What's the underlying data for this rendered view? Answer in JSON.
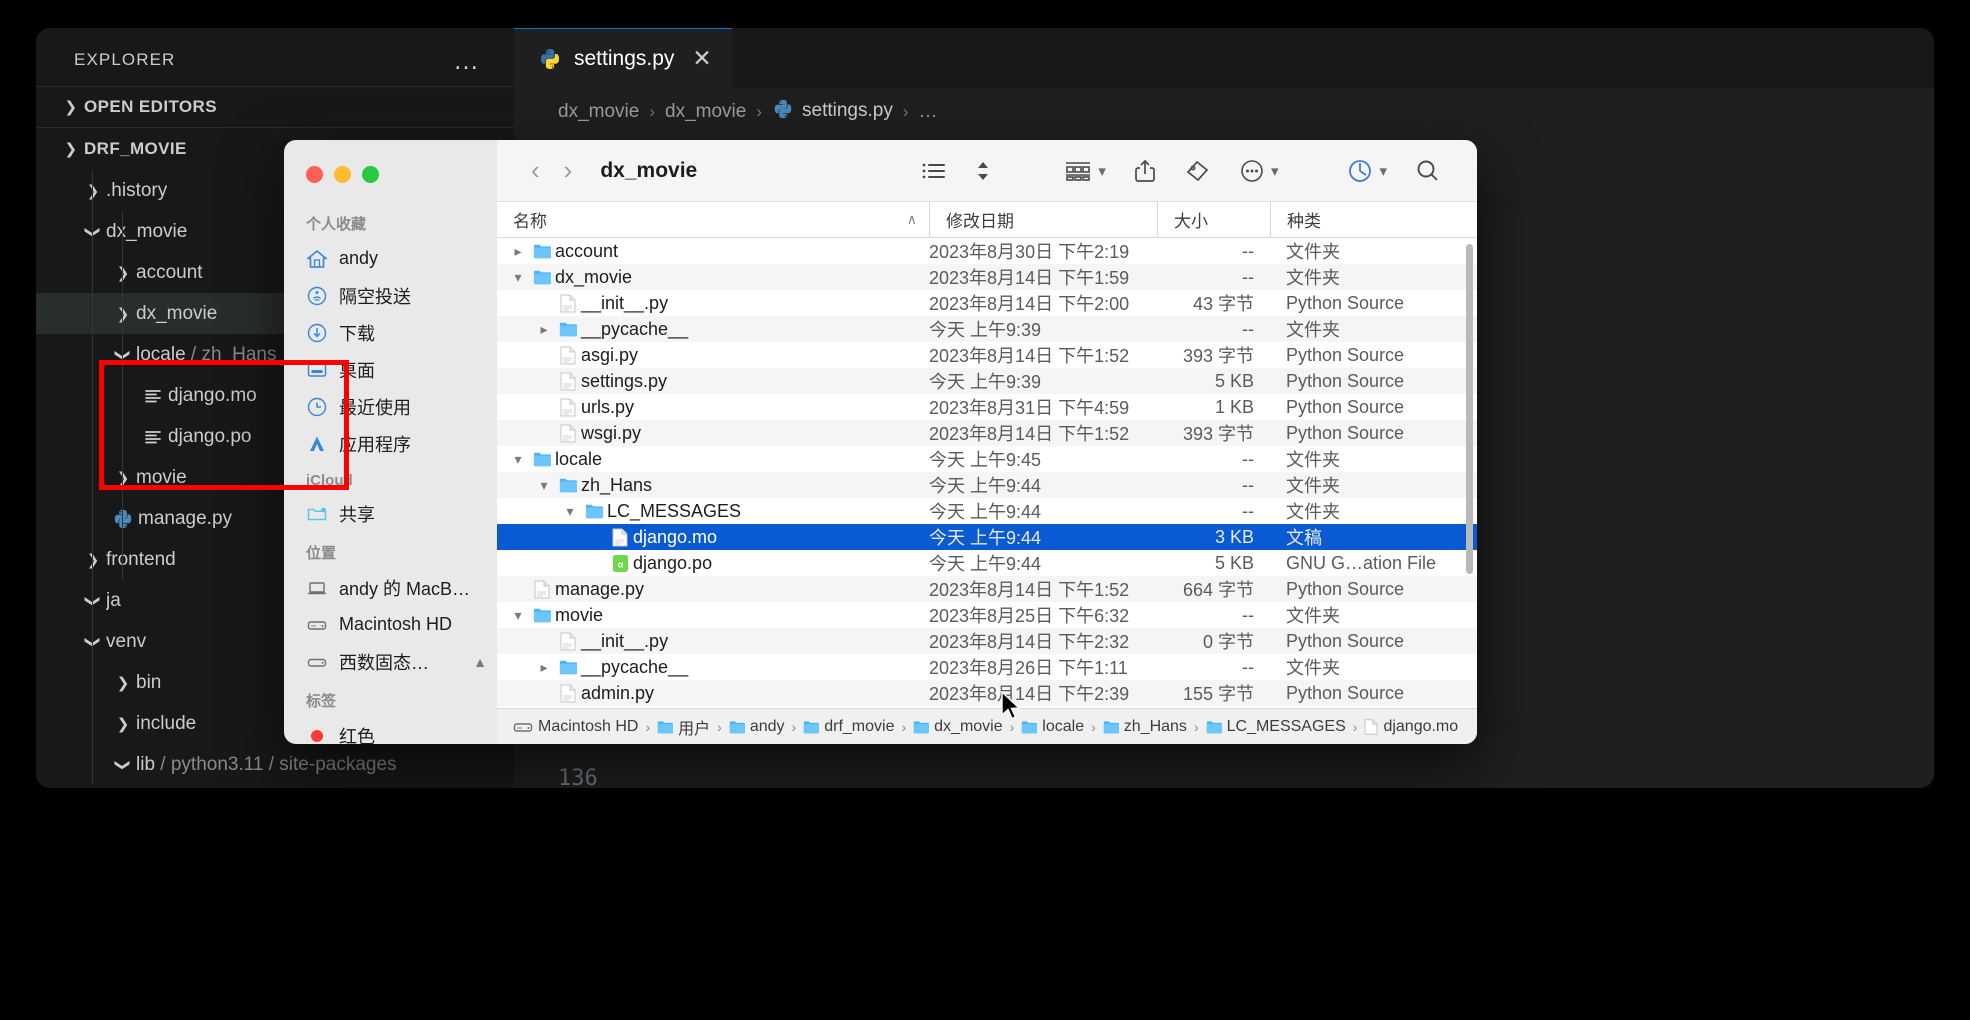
{
  "vscode": {
    "explorer": {
      "title": "EXPLORER",
      "more_label": "…",
      "open_editors_label": "OPEN EDITORS",
      "project_label": "DRF_MOVIE"
    },
    "tree": [
      {
        "label": ".history",
        "icon": "folder",
        "state": "collapsed",
        "indent": 1
      },
      {
        "label": "dx_movie",
        "icon": "folder",
        "state": "expanded",
        "indent": 1
      },
      {
        "label": "account",
        "icon": "folder",
        "state": "collapsed",
        "indent": 2
      },
      {
        "label": "dx_movie",
        "icon": "folder",
        "state": "collapsed",
        "indent": 2,
        "selected": true
      },
      {
        "label": "locale",
        "suffix": "/ zh_Hans",
        "icon": "folder",
        "state": "expanded",
        "indent": 2
      },
      {
        "label": "django.mo",
        "icon": "text-file",
        "state": "leaf",
        "indent": 3
      },
      {
        "label": "django.po",
        "icon": "text-file",
        "state": "leaf",
        "indent": 3
      },
      {
        "label": "movie",
        "icon": "folder",
        "state": "collapsed",
        "indent": 2
      },
      {
        "label": "manage.py",
        "icon": "python",
        "state": "leaf",
        "indent": 2
      },
      {
        "label": "frontend",
        "icon": "folder",
        "state": "collapsed",
        "indent": 1
      },
      {
        "label": "ja",
        "icon": "folder",
        "state": "expanded",
        "indent": 1
      },
      {
        "label": "venv",
        "icon": "folder",
        "state": "expanded",
        "indent": 1
      },
      {
        "label": "bin",
        "icon": "folder",
        "state": "collapsed",
        "indent": 2
      },
      {
        "label": "include",
        "icon": "folder",
        "state": "collapsed",
        "indent": 2
      },
      {
        "label": "lib",
        "suffix": "/ python3.11 / site-packages",
        "icon": "folder",
        "state": "expanded",
        "indent": 2
      }
    ],
    "tab": {
      "label": "settings.py",
      "close_label": "✕",
      "icon": "python-icon"
    },
    "breadcrumb": [
      "dx_movie",
      "dx_movie",
      "settings.py",
      "…"
    ],
    "code": {
      "line_number": "136"
    }
  },
  "finder": {
    "window_title": "dx_movie",
    "toolbar": {
      "back_label": "‹",
      "forward_label": "›",
      "view_icon": "list-view-icon",
      "sort_icon": "sort-icon",
      "group_icon": "group-by-icon",
      "share_icon": "share-icon",
      "tag_icon": "tag-icon",
      "more_icon": "more-ellipsis-icon",
      "sync_icon": "sync-icon",
      "search_icon": "search-icon"
    },
    "sidebar": {
      "groups": [
        {
          "title": "个人收藏",
          "items": [
            {
              "label": "andy",
              "icon": "home-icon"
            },
            {
              "label": "隔空投送",
              "icon": "airdrop-icon"
            },
            {
              "label": "下载",
              "icon": "downloads-icon"
            },
            {
              "label": "桌面",
              "icon": "desktop-icon"
            },
            {
              "label": "最近使用",
              "icon": "recents-icon"
            },
            {
              "label": "应用程序",
              "icon": "applications-icon"
            }
          ]
        },
        {
          "title": "iCloud",
          "items": [
            {
              "label": "共享",
              "icon": "shared-folder-icon"
            }
          ]
        },
        {
          "title": "位置",
          "items": [
            {
              "label": "andy 的 MacB…",
              "icon": "laptop-icon"
            },
            {
              "label": "Macintosh HD",
              "icon": "drive-icon"
            },
            {
              "label": "西数固态…",
              "icon": "external-drive-icon",
              "eject": true
            }
          ]
        },
        {
          "title": "标签",
          "items": [
            {
              "label": "红色",
              "icon": "red-tag-icon"
            }
          ]
        }
      ]
    },
    "columns": {
      "name": "名称",
      "date": "修改日期",
      "size": "大小",
      "kind": "种类",
      "sort_indicator": "∧"
    },
    "rows": [
      {
        "name": "account",
        "indent": 0,
        "icon": "folder",
        "disc": "collapsed",
        "date": "2023年8月30日 下午2:19",
        "size": "--",
        "kind": "文件夹"
      },
      {
        "name": "dx_movie",
        "indent": 0,
        "icon": "folder",
        "disc": "expanded",
        "date": "2023年8月14日 下午1:59",
        "size": "--",
        "kind": "文件夹"
      },
      {
        "name": "__init__.py",
        "indent": 1,
        "icon": "doc",
        "disc": "none",
        "date": "2023年8月14日 下午2:00",
        "size": "43 字节",
        "kind": "Python Source"
      },
      {
        "name": "__pycache__",
        "indent": 1,
        "icon": "folder",
        "disc": "collapsed",
        "date": "今天 上午9:39",
        "size": "--",
        "kind": "文件夹"
      },
      {
        "name": "asgi.py",
        "indent": 1,
        "icon": "doc",
        "disc": "none",
        "date": "2023年8月14日 下午1:52",
        "size": "393 字节",
        "kind": "Python Source"
      },
      {
        "name": "settings.py",
        "indent": 1,
        "icon": "doc",
        "disc": "none",
        "date": "今天 上午9:39",
        "size": "5 KB",
        "kind": "Python Source"
      },
      {
        "name": "urls.py",
        "indent": 1,
        "icon": "doc",
        "disc": "none",
        "date": "2023年8月31日 下午4:59",
        "size": "1 KB",
        "kind": "Python Source"
      },
      {
        "name": "wsgi.py",
        "indent": 1,
        "icon": "doc",
        "disc": "none",
        "date": "2023年8月14日 下午1:52",
        "size": "393 字节",
        "kind": "Python Source"
      },
      {
        "name": "locale",
        "indent": 0,
        "icon": "folder",
        "disc": "expanded",
        "date": "今天 上午9:45",
        "size": "--",
        "kind": "文件夹"
      },
      {
        "name": "zh_Hans",
        "indent": 1,
        "icon": "folder",
        "disc": "expanded",
        "date": "今天 上午9:44",
        "size": "--",
        "kind": "文件夹"
      },
      {
        "name": "LC_MESSAGES",
        "indent": 2,
        "icon": "folder",
        "disc": "expanded",
        "date": "今天 上午9:44",
        "size": "--",
        "kind": "文件夹"
      },
      {
        "name": "django.mo",
        "indent": 3,
        "icon": "doc",
        "disc": "none",
        "date": "今天 上午9:44",
        "size": "3 KB",
        "kind": "文稿",
        "selected": true
      },
      {
        "name": "django.po",
        "indent": 3,
        "icon": "po",
        "disc": "none",
        "date": "今天 上午9:44",
        "size": "5 KB",
        "kind": "GNU G…ation File"
      },
      {
        "name": "manage.py",
        "indent": 0,
        "icon": "doc",
        "disc": "none",
        "date": "2023年8月14日 下午1:52",
        "size": "664 字节",
        "kind": "Python Source"
      },
      {
        "name": "movie",
        "indent": 0,
        "icon": "folder",
        "disc": "expanded",
        "date": "2023年8月25日 下午6:32",
        "size": "--",
        "kind": "文件夹"
      },
      {
        "name": "__init__.py",
        "indent": 1,
        "icon": "doc",
        "disc": "none",
        "date": "2023年8月14日 下午2:32",
        "size": "0 字节",
        "kind": "Python Source"
      },
      {
        "name": "__pycache__",
        "indent": 1,
        "icon": "folder",
        "disc": "collapsed",
        "date": "2023年8月26日 下午1:11",
        "size": "--",
        "kind": "文件夹"
      },
      {
        "name": "admin.py",
        "indent": 1,
        "icon": "doc",
        "disc": "none",
        "date": "2023年8月14日 下午2:39",
        "size": "155 字节",
        "kind": "Python Source"
      }
    ],
    "path_bar": [
      {
        "label": "Macintosh HD",
        "icon": "drive-icon"
      },
      {
        "label": "用户",
        "icon": "folder-icon"
      },
      {
        "label": "andy",
        "icon": "folder-icon"
      },
      {
        "label": "drf_movie",
        "icon": "folder-icon"
      },
      {
        "label": "dx_movie",
        "icon": "folder-icon"
      },
      {
        "label": "locale",
        "icon": "folder-icon"
      },
      {
        "label": "zh_Hans",
        "icon": "folder-icon"
      },
      {
        "label": "LC_MESSAGES",
        "icon": "folder-icon"
      },
      {
        "label": "django.mo",
        "icon": "doc-icon"
      }
    ]
  },
  "colors": {
    "annotation_red": "#ff0000",
    "selection_blue": "#0a5bd3",
    "folder_blue": "#4cb5f5",
    "tab_accent": "#0078d4"
  }
}
